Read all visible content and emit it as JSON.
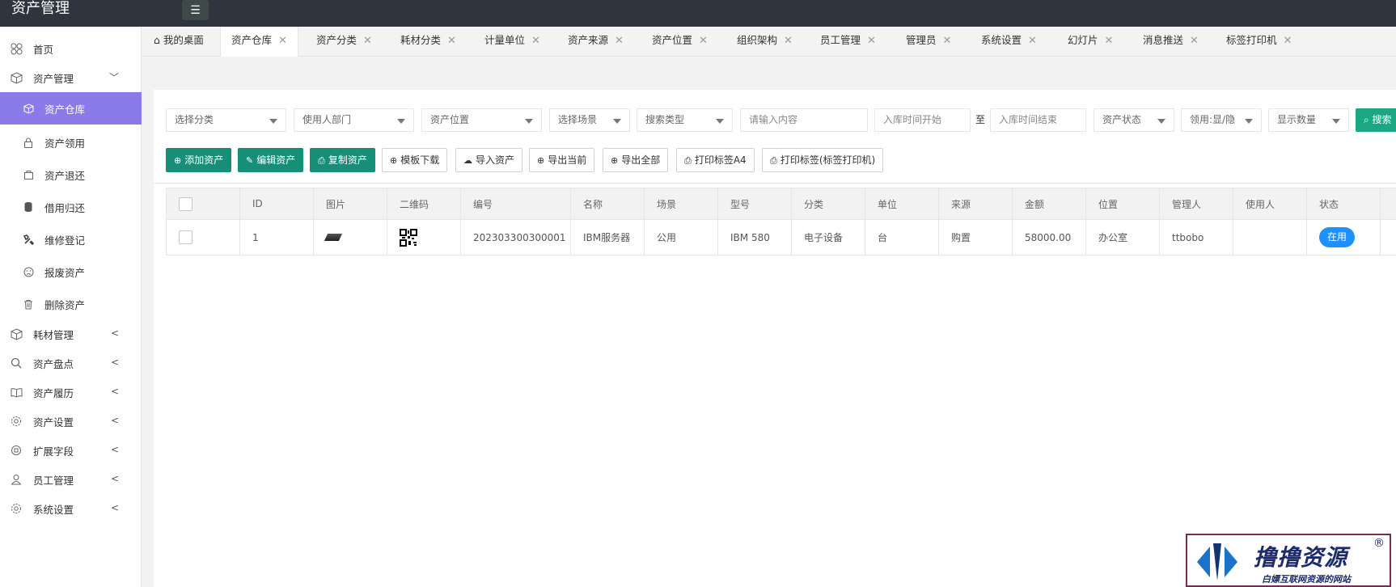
{
  "app": {
    "title": "资产管理"
  },
  "sidebar": {
    "items": [
      {
        "label": "首页",
        "icon": "home-cluster-icon"
      },
      {
        "label": "资产管理",
        "icon": "box-icon",
        "expanded": true
      },
      {
        "label": "资产仓库",
        "icon": "cube-icon",
        "active": true
      },
      {
        "label": "资产领用",
        "icon": "lock-icon"
      },
      {
        "label": "资产退还",
        "icon": "return-icon"
      },
      {
        "label": "借用归还",
        "icon": "cylinder-icon"
      },
      {
        "label": "维修登记",
        "icon": "tools-icon"
      },
      {
        "label": "报废资产",
        "icon": "sad-face-icon"
      },
      {
        "label": "删除资产",
        "icon": "trash-icon"
      },
      {
        "label": "耗材管理",
        "icon": "box-icon"
      },
      {
        "label": "资产盘点",
        "icon": "search-icon"
      },
      {
        "label": "资产履历",
        "icon": "book-icon"
      },
      {
        "label": "资产设置",
        "icon": "gear-icon"
      },
      {
        "label": "扩展字段",
        "icon": "ext-icon"
      },
      {
        "label": "员工管理",
        "icon": "user-icon"
      },
      {
        "label": "系统设置",
        "icon": "gear-icon"
      }
    ]
  },
  "tabs": [
    {
      "label": "我的桌面"
    },
    {
      "label": "资产仓库"
    },
    {
      "label": "资产分类"
    },
    {
      "label": "耗材分类"
    },
    {
      "label": "计量单位"
    },
    {
      "label": "资产来源"
    },
    {
      "label": "资产位置"
    },
    {
      "label": "组织架构"
    },
    {
      "label": "员工管理"
    },
    {
      "label": "管理员"
    },
    {
      "label": "系统设置"
    },
    {
      "label": "幻灯片"
    },
    {
      "label": "消息推送"
    },
    {
      "label": "标签打印机"
    }
  ],
  "filters": {
    "category": "选择分类",
    "department": "使用人部门",
    "location": "资产位置",
    "scene": "选择场景",
    "search_type": "搜索类型",
    "keyword_placeholder": "请输入内容",
    "date_start_placeholder": "入库时间开始",
    "date_separator": "至",
    "date_end_placeholder": "入库时间结束",
    "status": "资产状态",
    "receive_toggle": "领用:显/隐",
    "show_count": "显示数量",
    "search_label": "搜索"
  },
  "toolbar": {
    "add": "添加资产",
    "edit": "编辑资产",
    "copy": "复制资产",
    "template": "模板下载",
    "import": "导入资产",
    "export_current": "导出当前",
    "export_all": "导出全部",
    "print_a4": "打印标签A4",
    "print_label": "打印标签(标签打印机)"
  },
  "table": {
    "columns": [
      "ID",
      "图片",
      "二维码",
      "编号",
      "名称",
      "场景",
      "型号",
      "分类",
      "单位",
      "来源",
      "金额",
      "位置",
      "管理人",
      "使用人",
      "状态"
    ],
    "rows": [
      {
        "id": "1",
        "code": "202303300300001",
        "name": "IBM服务器",
        "scene": "公用",
        "model": "IBM 580",
        "category": "电子设备",
        "unit": "台",
        "source": "购置",
        "amount": "58000.00",
        "location": "办公室",
        "manager": "ttbobo",
        "user": "",
        "status": "在用"
      }
    ]
  },
  "watermark": {
    "title": "撸撸资源",
    "subtitle": "白嫖互联网资源的网站",
    "reg": "®"
  }
}
